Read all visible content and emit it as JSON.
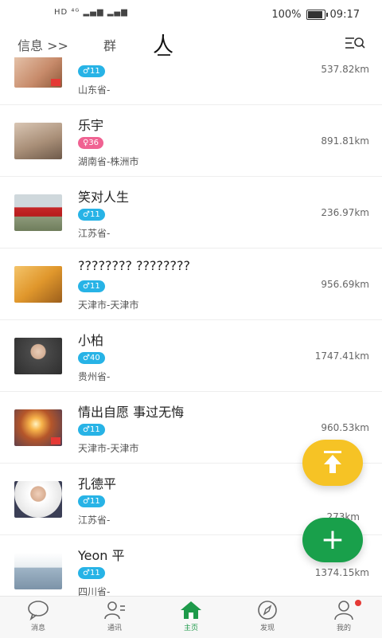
{
  "status_bar": {
    "left": "HD ⁴ᴳ ▂▄▆ ▂▄▆",
    "battery": "100%",
    "time": "09:17"
  },
  "header": {
    "tab_messages": "信息 >>",
    "tab_group": "群",
    "tab_people": "人"
  },
  "users": [
    {
      "name": "",
      "badge": "♂11",
      "gender": "male",
      "location": "山东省-",
      "distance": "537.82km"
    },
    {
      "name": "乐宇",
      "badge": "♀36",
      "gender": "female",
      "location": "湖南省-株洲市",
      "distance": "891.81km"
    },
    {
      "name": "笑对人生",
      "badge": "♂11",
      "gender": "male",
      "location": "江苏省-",
      "distance": "236.97km"
    },
    {
      "name": "???????? ????????",
      "badge": "♂11",
      "gender": "male",
      "location": "天津市-天津市",
      "distance": "956.69km"
    },
    {
      "name": "小柏",
      "badge": "♂40",
      "gender": "male",
      "location": "贵州省-",
      "distance": "1747.41km"
    },
    {
      "name": "情出自愿 事过无悔",
      "badge": "♂11",
      "gender": "male",
      "location": "天津市-天津市",
      "distance": "960.53km"
    },
    {
      "name": "孔德平",
      "badge": "♂11",
      "gender": "male",
      "location": "江苏省-",
      "distance": "273km"
    },
    {
      "name": "Yeon 平",
      "badge": "♂11",
      "gender": "male",
      "location": "四川省-",
      "distance": "1374.15km"
    }
  ],
  "nav": {
    "messages": "消息",
    "contacts": "通讯",
    "home": "主页",
    "discover": "发现",
    "me": "我的"
  },
  "colors": {
    "accent_green": "#1e9a4a",
    "fab_yellow": "#f6c325",
    "badge_male": "#27b3e6",
    "badge_female": "#f06292"
  }
}
